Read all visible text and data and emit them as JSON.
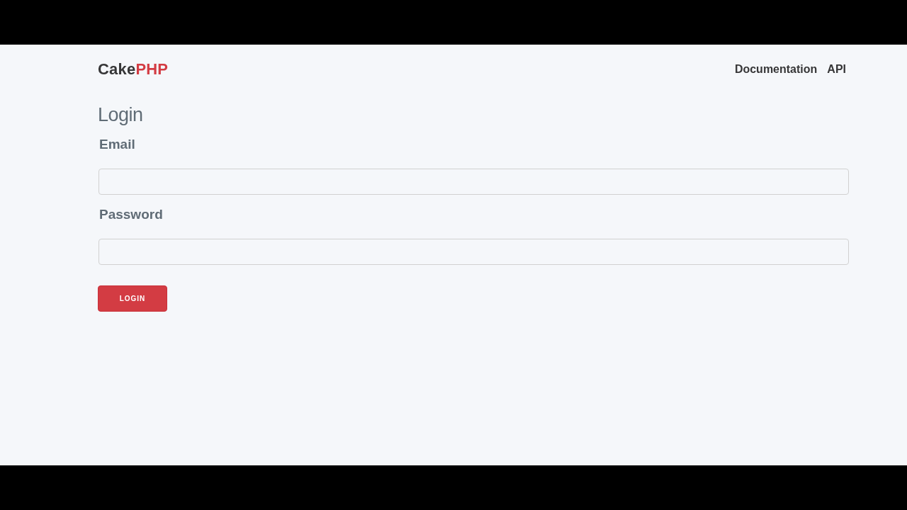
{
  "header": {
    "logo": {
      "main": "Cake",
      "accent": "PHP"
    },
    "nav": [
      {
        "label": "Documentation"
      },
      {
        "label": "API"
      }
    ]
  },
  "form": {
    "title": "Login",
    "fields": [
      {
        "label": "Email"
      },
      {
        "label": "Password"
      }
    ],
    "submit": "LOGIN"
  }
}
